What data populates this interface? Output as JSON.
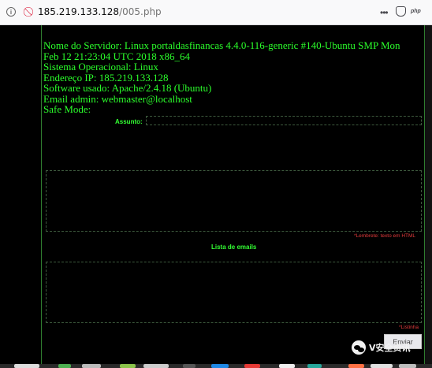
{
  "browser": {
    "url_host": "185.219.133.128",
    "url_path": "/005.php",
    "php_badge": "php",
    "more": "•••"
  },
  "server_info": [
    "Nome do Servidor: Linux portaldasfinancas 4.4.0-116-generic #140-Ubuntu SMP Mon",
    "Feb 12 21:23:04 UTC 2018 x86_64",
    "Sistema Operacional: Linux",
    "Endereço IP: 185.219.133.128",
    "Software usado: Apache/2.4.18 (Ubuntu)",
    "Email admin: webmaster@localhost",
    "Safe Mode:"
  ],
  "form": {
    "subject_label": "Assunto:",
    "subject_value": "",
    "message_value": "",
    "html_hint": "*Lembrete: texto em HTML",
    "email_list_label": "Lista de emails",
    "email_list_value": "",
    "list_hint": "*Listinha",
    "send_button": "Enviar"
  },
  "watermark": "V安全资讯",
  "colors": {
    "text_green": "#2bff2b",
    "hint_red": "#e23b3b",
    "background": "#000000"
  }
}
